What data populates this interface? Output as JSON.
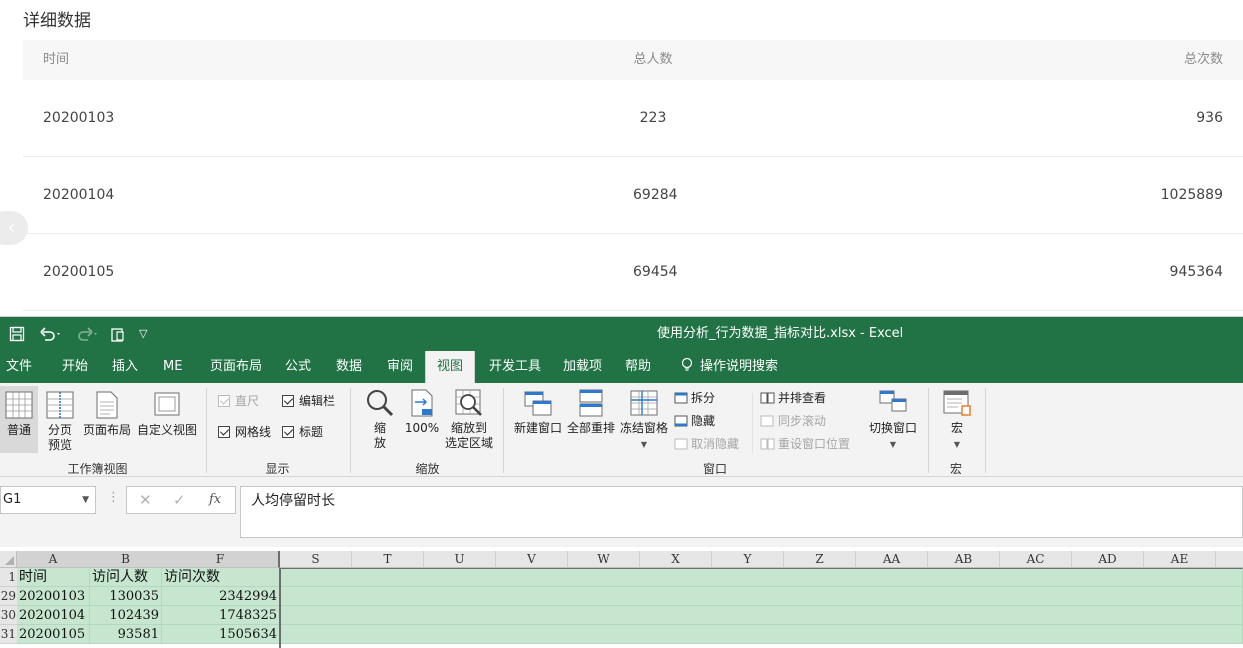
{
  "report": {
    "title": "详细数据",
    "headers": [
      "时间",
      "总人数",
      "总次数"
    ],
    "rows": [
      [
        "20200103",
        "223",
        "936"
      ],
      [
        "20200104",
        "69284",
        "1025889"
      ],
      [
        "20200105",
        "69454",
        "945364"
      ]
    ]
  },
  "excel": {
    "window_title": "使用分析_行为数据_指标对比.xlsx  -  Excel",
    "tabs": [
      "文件",
      "开始",
      "插入",
      "ME",
      "页面布局",
      "公式",
      "数据",
      "审阅",
      "视图",
      "开发工具",
      "加载项",
      "帮助",
      "操作说明搜索"
    ],
    "active_tab": "视图",
    "ribbon": {
      "workbook_views": {
        "normal": "普通",
        "page_break_1": "分页",
        "page_break_2": "预览",
        "page_layout": "页面布局",
        "custom_views": "自定义视图",
        "group": "工作簿视图"
      },
      "show": {
        "ruler": "直尺",
        "formula_bar": "编辑栏",
        "gridlines": "网格线",
        "headings": "标题",
        "group": "显示"
      },
      "zoom": {
        "zoom_1": "缩",
        "zoom_2": "放",
        "hundred": "100%",
        "to_sel_1": "缩放到",
        "to_sel_2": "选定区域",
        "group": "缩放"
      },
      "window": {
        "new_window": "新建窗口",
        "arrange_all": "全部重排",
        "freeze_panes": "冻结窗格",
        "split": "拆分",
        "hide": "隐藏",
        "unhide": "取消隐藏",
        "side_by_side": "并排查看",
        "sync_scroll": "同步滚动",
        "reset_position": "重设窗口位置",
        "switch_windows": "切换窗口",
        "group": "窗口"
      },
      "macros": {
        "macros": "宏",
        "group": "宏"
      }
    },
    "name_box": "G1",
    "formula": "人均停留时长",
    "columns": [
      "A",
      "B",
      "F",
      "S",
      "T",
      "U",
      "V",
      "W",
      "X",
      "Y",
      "Z",
      "AA",
      "AB",
      "AC",
      "AD",
      "AE"
    ],
    "row_numbers": [
      "1",
      "29",
      "30",
      "31"
    ],
    "cells": [
      [
        "时间",
        "访问人数",
        "访问次数"
      ],
      [
        "20200103",
        "130035",
        "2342994"
      ],
      [
        "20200104",
        "102439",
        "1748325"
      ],
      [
        "20200105",
        "93581",
        "1505634"
      ]
    ]
  }
}
